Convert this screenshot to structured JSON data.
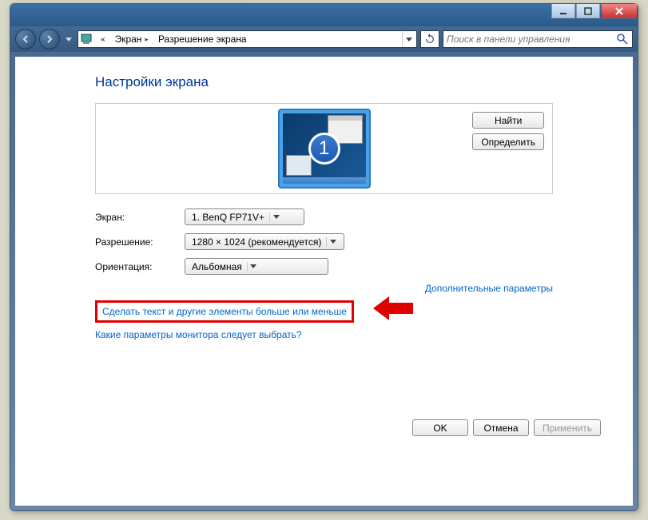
{
  "breadcrumb": {
    "level1": "Экран",
    "level2": "Разрешение экрана"
  },
  "search_placeholder": "Поиск в панели управления",
  "title": "Настройки экрана",
  "monitor_number": "1",
  "buttons": {
    "find": "Найти",
    "detect": "Определить",
    "ok": "OK",
    "cancel": "Отмена",
    "apply": "Применить"
  },
  "labels": {
    "display": "Экран:",
    "resolution": "Разрешение:",
    "orientation": "Ориентация:"
  },
  "values": {
    "display": "1. BenQ FP71V+",
    "resolution": "1280 × 1024 (рекомендуется)",
    "orientation": "Альбомная"
  },
  "links": {
    "advanced": "Дополнительные параметры",
    "text_size": "Сделать текст и другие элементы больше или меньше",
    "help": "Какие параметры монитора следует выбрать?"
  }
}
